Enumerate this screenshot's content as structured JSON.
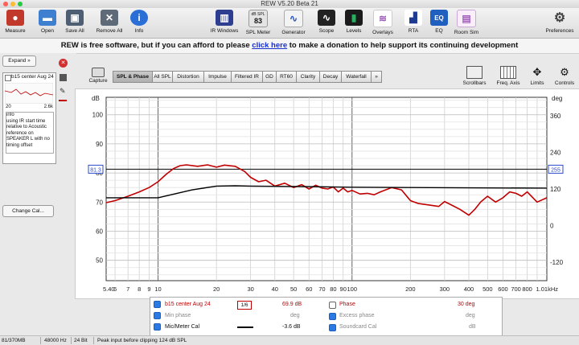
{
  "window": {
    "title": "REW V5.20 Beta 21"
  },
  "toolbar": {
    "left": [
      {
        "id": "measure",
        "label": "Measure",
        "icon": "microphone-icon",
        "color": "#c0392b"
      },
      {
        "id": "open",
        "label": "Open",
        "icon": "folder-icon",
        "color": "#3f7fd0"
      },
      {
        "id": "save_all",
        "label": "Save All",
        "icon": "save-icon",
        "color": "#4f5f73"
      },
      {
        "id": "remove_all",
        "label": "Remove All",
        "icon": "trash-icon",
        "color": "#5e6a78"
      },
      {
        "id": "info",
        "label": "Info",
        "icon": "info-icon",
        "color": "#2a6fd6"
      }
    ],
    "center": [
      {
        "id": "ir_windows",
        "label": "IR Windows",
        "icon": "ir-windows-icon",
        "color": "#2d3d8f"
      },
      {
        "id": "spl_meter",
        "label": "SPL Meter",
        "icon": "spl-meter-icon",
        "color": "#dcdcdc"
      },
      {
        "id": "generator",
        "label": "Generator",
        "icon": "generator-icon",
        "color": "#eeeeee"
      },
      {
        "id": "scope",
        "label": "Scope",
        "icon": "scope-icon",
        "color": "#222222"
      },
      {
        "id": "levels",
        "label": "Levels",
        "icon": "levels-icon",
        "color": "#27ae60"
      },
      {
        "id": "overlays",
        "label": "Overlays",
        "icon": "overlays-icon",
        "color": "#9b59b6"
      },
      {
        "id": "rta",
        "label": "RTA",
        "icon": "rta-icon",
        "color": "#1f3a93"
      },
      {
        "id": "eq",
        "label": "EQ",
        "icon": "eq-icon",
        "color": "#1f5fbf"
      },
      {
        "id": "room_sim",
        "label": "Room Sim",
        "icon": "room-sim-icon",
        "color": "#c0a0d0"
      }
    ],
    "right": {
      "id": "preferences",
      "label": "Preferences",
      "icon": "gear-icon"
    },
    "spl_meter_display": {
      "unit": "dB SPL",
      "value": "83"
    }
  },
  "banner": {
    "prefix": "REW is free software, but if you can afford to please",
    "link": "click here",
    "suffix": "to make a donation to help support its continuing development"
  },
  "left_panel": {
    "expand_label": "Expand",
    "measurement": {
      "name": "b15 center Aug 24",
      "range_start": "20",
      "range_end": "2.6k"
    },
    "notes": [
      "info",
      "using IR start time",
      "relative to Acoustic",
      "reference on",
      "SPEAKER L with no",
      "timing offset"
    ],
    "change_cal_label": "Change Cal..."
  },
  "capture_label": "Capture",
  "tabs": [
    "SPL & Phase",
    "All SPL",
    "Distortion",
    "Impulse",
    "Filtered IR",
    "GD",
    "RT60",
    "Clarity",
    "Decay",
    "Waterfall"
  ],
  "tabs_more": "»",
  "graph_tools": [
    {
      "label": "Scrollbars",
      "icon": "scrollbars-icon"
    },
    {
      "label": "Freq. Axis",
      "icon": "freq-axis-icon"
    },
    {
      "label": "Limits",
      "icon": "limits-icon"
    },
    {
      "label": "Controls",
      "icon": "controls-icon"
    }
  ],
  "chart_data": {
    "type": "line",
    "xscale": "log",
    "xlim": [
      5.4,
      1010
    ],
    "ylabel_left": "dB",
    "ylabel_right": "deg",
    "ylim": [
      43,
      106
    ],
    "ylim_right": [
      -180,
      420
    ],
    "yticks": [
      50,
      60,
      70,
      80,
      90,
      100
    ],
    "yticks_right": [
      -120,
      0,
      120,
      240,
      360
    ],
    "xticks": [
      {
        "v": 5.4,
        "label": "5.40"
      },
      {
        "v": 6,
        "label": "6"
      },
      {
        "v": 7,
        "label": "7"
      },
      {
        "v": 8,
        "label": "8"
      },
      {
        "v": 9,
        "label": "9"
      },
      {
        "v": 10,
        "label": "10"
      },
      {
        "v": 20,
        "label": "20"
      },
      {
        "v": 30,
        "label": "30"
      },
      {
        "v": 40,
        "label": "40"
      },
      {
        "v": 50,
        "label": "50"
      },
      {
        "v": 60,
        "label": "60"
      },
      {
        "v": 70,
        "label": "70"
      },
      {
        "v": 80,
        "label": "80"
      },
      {
        "v": 90,
        "label": "90"
      },
      {
        "v": 100,
        "label": "100"
      },
      {
        "v": 200,
        "label": "200"
      },
      {
        "v": 300,
        "label": "300"
      },
      {
        "v": 400,
        "label": "400"
      },
      {
        "v": 500,
        "label": "500"
      },
      {
        "v": 600,
        "label": "600"
      },
      {
        "v": 700,
        "label": "700"
      },
      {
        "v": 800,
        "label": "800"
      },
      {
        "v": 1010,
        "label": "1.01kHz"
      }
    ],
    "y_cursor_left": "81.3",
    "y_cursor_right": "255",
    "reference_line": 81.3,
    "grid": true,
    "series": [
      {
        "name": "b15 center Aug 24",
        "color": "#c00000",
        "x": [
          5.4,
          6,
          7,
          8,
          9,
          10,
          11,
          12,
          13,
          14,
          16,
          18,
          20,
          22,
          25,
          28,
          30,
          33,
          36,
          40,
          45,
          50,
          55,
          60,
          65,
          70,
          75,
          80,
          85,
          90,
          95,
          100,
          110,
          120,
          130,
          140,
          160,
          180,
          200,
          220,
          250,
          280,
          300,
          330,
          360,
          400,
          430,
          460,
          500,
          550,
          600,
          650,
          700,
          750,
          800,
          900,
          1010
        ],
        "values": [
          69.8,
          70.5,
          72.0,
          73.5,
          75.0,
          77.0,
          79.5,
          81.5,
          82.5,
          82.8,
          82.3,
          82.8,
          82.0,
          82.7,
          82.3,
          80.5,
          78.5,
          77.0,
          77.5,
          75.5,
          76.5,
          75.0,
          76.0,
          74.5,
          75.8,
          74.8,
          74.5,
          75.2,
          73.5,
          74.8,
          73.5,
          74.0,
          72.8,
          73.0,
          72.5,
          73.5,
          75.0,
          74.2,
          70.5,
          69.5,
          69.0,
          68.5,
          70.2,
          68.8,
          67.5,
          65.5,
          67.5,
          70.0,
          72.0,
          70.0,
          71.5,
          73.5,
          73.0,
          72.0,
          73.5,
          70.0,
          71.5
        ]
      },
      {
        "name": "Mic/Meter Cal",
        "color": "#000000",
        "x": [
          5.4,
          10,
          15,
          20,
          25,
          30,
          40,
          60,
          100,
          200,
          400,
          1010
        ],
        "values": [
          71.5,
          71.5,
          74.2,
          75.5,
          75.6,
          75.5,
          75.4,
          75.3,
          75.1,
          75.0,
          74.9,
          74.8
        ]
      }
    ]
  },
  "legend": {
    "row1": {
      "name": "b15 center Aug 24",
      "smoothing": "1/6",
      "value": "69.9 dB",
      "phase_label": "Phase",
      "phase_value": "30 deg"
    },
    "row2": {
      "min_phase_label": "Min phase",
      "min_phase_unit": "deg",
      "excess_phase_label": "Excess phase",
      "excess_phase_unit": "deg"
    },
    "row3": {
      "name": "Mic/Meter Cal",
      "value": "-3.6 dB",
      "soundcard_label": "Soundcard Cal",
      "soundcard_unit": "dB"
    }
  },
  "status": {
    "memory": "81/370MB",
    "sample_rate": "48000 Hz",
    "bit_depth": "24 Bit",
    "message": "Peak input before clipping 124 dB SPL"
  }
}
